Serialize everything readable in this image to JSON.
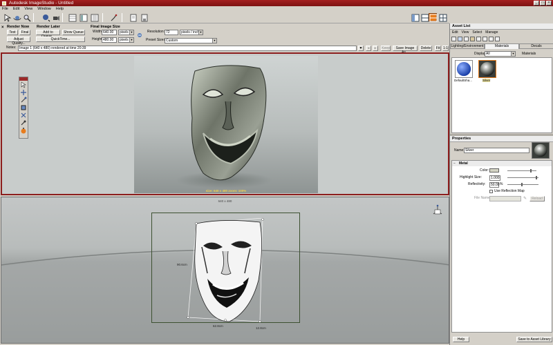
{
  "window": {
    "title": "Autodesk ImageStudio - Untitled",
    "controls": [
      "_",
      "□",
      "×"
    ]
  },
  "menu": [
    "File",
    "Edit",
    "View",
    "Window",
    "Help"
  ],
  "toolbar_icons": [
    "pointer-icon",
    "orbit-icon",
    "zoom-icon",
    "light-icon",
    "camera-icon",
    "grid-icon",
    "panel-icon",
    "list-icon",
    "pan-icon",
    "render-icon",
    "save-icon",
    "layout1-icon",
    "layout2-icon",
    "layout3-icon",
    "layout4-icon"
  ],
  "render_now": {
    "title": "Render Now",
    "test": "Test",
    "final": "Final",
    "adjust": "Adjust Quality..."
  },
  "render_later": {
    "title": "Render Later",
    "add": "Add to Queue...",
    "show": "Show Queue",
    "quicktime": "QuickTime..."
  },
  "image_size": {
    "title": "Final Image Size",
    "width_label": "Width:",
    "width_value": "640.00",
    "width_unit": "pixels",
    "height_label": "Height:",
    "height_value": "480.00",
    "height_unit": "pixels"
  },
  "resolution": {
    "label": "Resolution:",
    "value": "72",
    "unit": "pixels / inch",
    "preset_label": "Preset Sizes:",
    "preset_value": "Custom"
  },
  "notes": {
    "label": "Notes:",
    "value": "Image 1 (640 x 480) rendered at time 20:39",
    "keep": "Keep",
    "save_image": "Save Image As...",
    "delete": "Delete",
    "fit": "Fit",
    "one_to_one": "1:1"
  },
  "viewport_top": {
    "caption": "size: 640 x 480 zoom: 100%"
  },
  "viewport_bottom": {
    "size_label": "640 x 480",
    "dim_height": "90.6cm",
    "dim_width": "62.8cm",
    "dim_depth": "12.8cm"
  },
  "asset_list": {
    "title": "Asset List",
    "menu": [
      "Edit",
      "View",
      "Select",
      "Manage"
    ],
    "tabs": [
      "Lighting/Environment",
      "Materials",
      "Decals"
    ],
    "active_tab": 1,
    "display_label": "Display:",
    "display_value": "All",
    "display_suffix": "Materials",
    "swatches": [
      {
        "name": "DefaultSha...",
        "color": "#1a4fd0"
      },
      {
        "name": "Silver",
        "color": "#c0c0c0"
      }
    ]
  },
  "properties": {
    "title": "Properties",
    "name_label": "Name:",
    "name_value": "Silver",
    "section": "Metal",
    "color_label": "Color:",
    "color_value": "#d4d4c4",
    "highlight_label": "Highlight Size:",
    "highlight_value": "1.000",
    "reflectivity_label": "Reflectivity:",
    "reflectivity_value": "50.00",
    "reflectivity_unit": "%",
    "use_reflection": "Use Reflection Map",
    "file_name_label": "File Name:",
    "reload": "Reload"
  },
  "footer": {
    "help": "Help",
    "save_library": "Save to Asset Library"
  },
  "colors": {
    "title_bar": "#8c1d1d",
    "accent_orange": "#e87c1c"
  }
}
